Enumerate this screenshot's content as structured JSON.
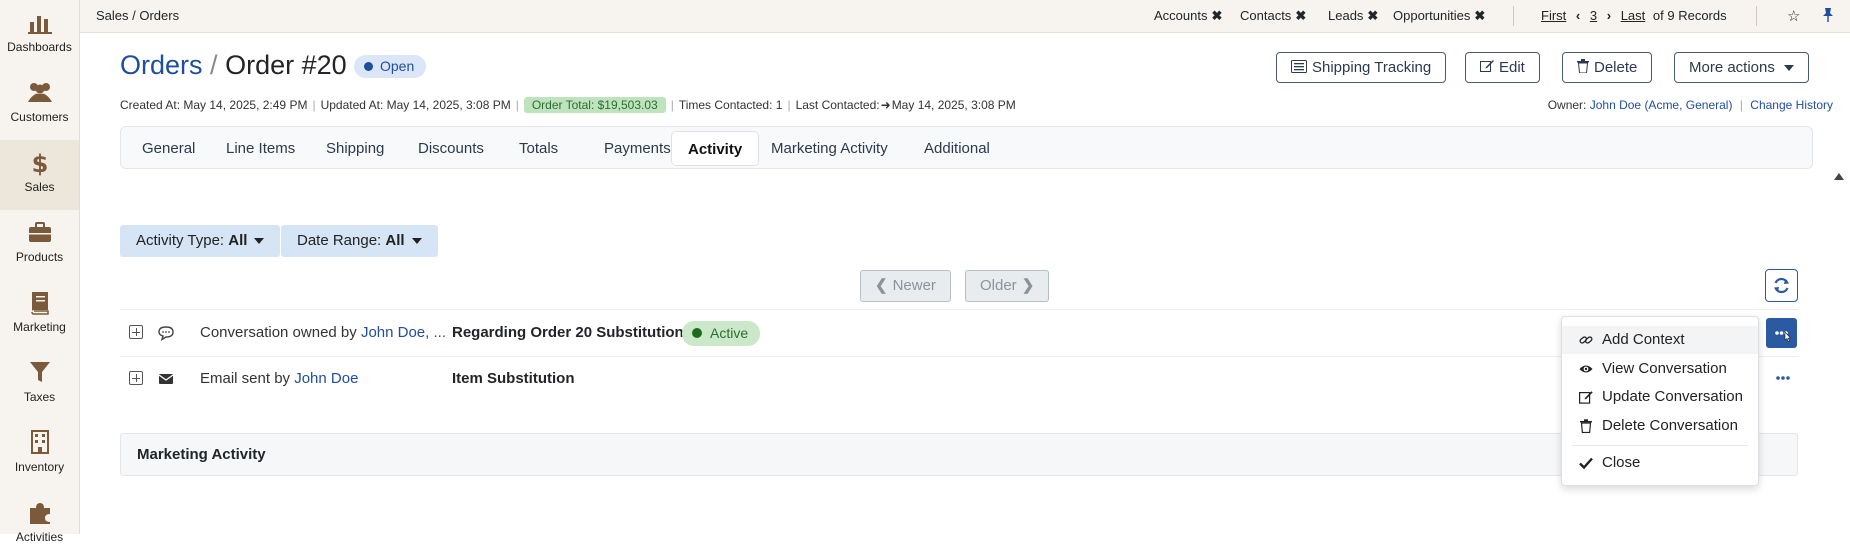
{
  "sidebar": {
    "items": [
      {
        "label": "Dashboards",
        "icon": "dashboard-chart-icon"
      },
      {
        "label": "Customers",
        "icon": "people-icon"
      },
      {
        "label": "Sales",
        "icon": "dollar-icon"
      },
      {
        "label": "Products",
        "icon": "briefcase-icon"
      },
      {
        "label": "Marketing",
        "icon": "book-icon"
      },
      {
        "label": "Taxes",
        "icon": "funnel-icon"
      },
      {
        "label": "Inventory",
        "icon": "building-icon"
      },
      {
        "label": "Activities",
        "icon": "puzzle-icon"
      }
    ],
    "active": "Sales"
  },
  "topbar": {
    "breadcrumb": "Sales / Orders",
    "quick_tabs": [
      "Accounts",
      "Contacts",
      "Leads",
      "Opportunities"
    ],
    "pager": {
      "first": "First",
      "page": "3",
      "last": "Last",
      "records": "of 9 Records"
    }
  },
  "header": {
    "module": "Orders",
    "separator": "/",
    "record": "Order #20",
    "status": "Open",
    "buttons": {
      "shipping": "Shipping Tracking",
      "edit": "Edit",
      "delete": "Delete",
      "more": "More actions"
    }
  },
  "meta": {
    "created": "Created At: May 14, 2025, 2:49 PM",
    "updated": "Updated At: May 14, 2025, 3:08 PM",
    "total": "Order Total: $19,503.03",
    "times_contacted": "Times Contacted: 1",
    "last_contacted_label": "Last Contacted:",
    "last_contacted_value": "May 14, 2025, 3:08 PM",
    "owner_label": "Owner:",
    "owner_value": "John Doe (Acme, General)",
    "change_history": "Change History"
  },
  "tabs": [
    "General",
    "Line Items",
    "Shipping",
    "Discounts",
    "Totals",
    "Payments",
    "Activity",
    "Marketing Activity",
    "Additional"
  ],
  "active_tab": "Activity",
  "filters": {
    "activity_type_label": "Activity Type:",
    "activity_type_value": "All",
    "date_range_label": "Date Range:",
    "date_range_value": "All"
  },
  "nav": {
    "newer": "Newer",
    "older": "Older"
  },
  "activities": [
    {
      "type_icon": "chat-bubble-icon",
      "desc": "Conversation owned by",
      "person": "John Doe, ...",
      "subject": "Regarding Order 20 Substitution",
      "status": "Active"
    },
    {
      "type_icon": "envelope-icon",
      "desc": "Email sent by",
      "person": "John Doe",
      "subject": "Item Substitution",
      "status": ""
    }
  ],
  "marketing_section": "Marketing Activity",
  "context_menu": {
    "items": [
      {
        "label": "Add Context",
        "icon": "link-icon"
      },
      {
        "label": "View Conversation",
        "icon": "eye-icon"
      },
      {
        "label": "Update Conversation",
        "icon": "pencil-square-icon"
      },
      {
        "label": "Delete Conversation",
        "icon": "trash-icon"
      }
    ],
    "close": "Close"
  },
  "colors": {
    "accent": "#2b5aa3",
    "link": "#1f4e9c",
    "sidebar_bg": "#f7f3ee",
    "active_badge": "#cbe8cb",
    "open_badge": "#dbe7f8"
  }
}
